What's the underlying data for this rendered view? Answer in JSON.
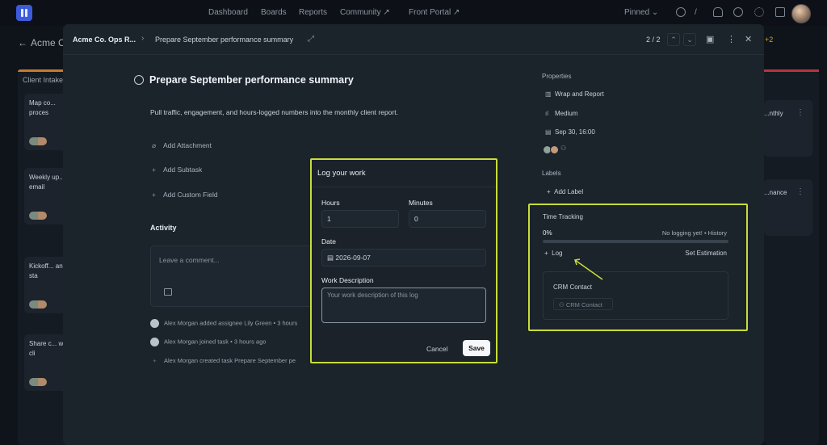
{
  "nav": {
    "items": [
      "Dashboard",
      "Boards",
      "Reports",
      "Community ↗",
      "Front Portal ↗"
    ],
    "pinned": "Pinned"
  },
  "board": {
    "title": "Acme C",
    "column_left": "Client Intake",
    "left_cards": [
      "Map co... proces",
      "Weekly up... email",
      "Kickoff... and sta",
      "Share c... with cli"
    ],
    "right_cards": [
      "...nthly",
      "...nance"
    ],
    "right_count": "+2"
  },
  "modal": {
    "breadcrumb": "Acme Co. Ops R...",
    "breadcrumb_task": "Prepare September performance summary",
    "pager": "2 / 2",
    "title": "Prepare September performance summary",
    "description": "Pull traffic, engagement, and hours-logged numbers into the monthly client report.",
    "actions": {
      "attachment": "Add Attachment",
      "subtask": "Add Subtask",
      "custom_field": "Add Custom Field"
    },
    "activity": {
      "heading": "Activity",
      "comment_placeholder": "Leave a comment...",
      "logs": [
        "Alex Morgan added assignee Lily Green • 3 hours",
        "Alex Morgan joined task • 3 hours ago",
        "Alex Morgan created task Prepare September pe"
      ]
    },
    "properties": {
      "heading": "Properties",
      "stage": "Wrap and Report",
      "priority": "Medium",
      "due": "Sep 30, 16:00"
    },
    "labels": {
      "heading": "Labels",
      "add": "Add Label"
    },
    "time_tracking": {
      "heading": "Time Tracking",
      "percent": "0%",
      "progress": 0,
      "status": "No logging yet! • History",
      "log": "Log",
      "estimation": "Set Estimation",
      "crm_label": "CRM Contact",
      "crm_field": "CRM Contact"
    }
  },
  "dialog": {
    "title": "Log your work",
    "hours_label": "Hours",
    "hours_value": "1",
    "minutes_label": "Minutes",
    "minutes_value": "0",
    "date_label": "Date",
    "date_value": "2026-09-07",
    "desc_label": "Work Description",
    "desc_placeholder": "Your work description of this log",
    "cancel": "Cancel",
    "save": "Save"
  },
  "colors": {
    "highlight": "#c7dd3a",
    "modal_bg": "#1b232b",
    "accent": "#3b5bdb"
  }
}
